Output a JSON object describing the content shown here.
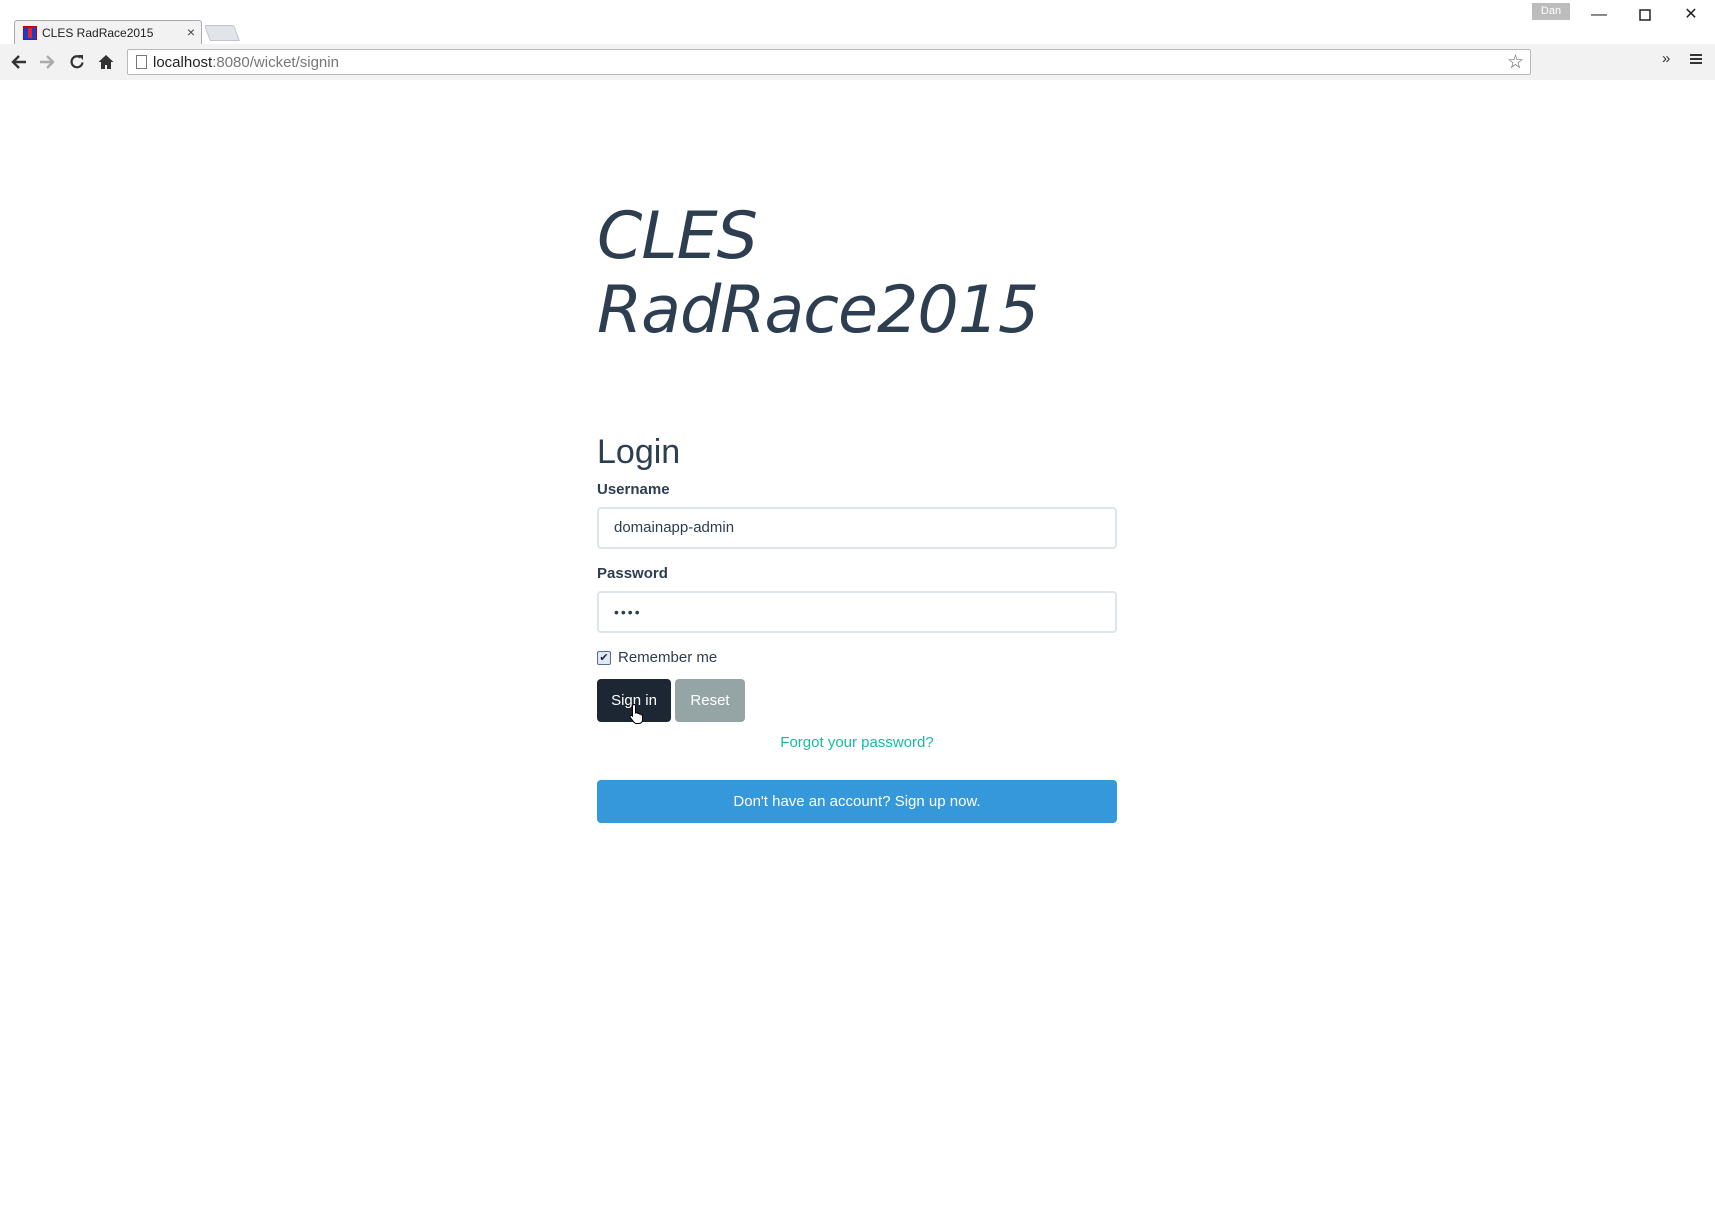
{
  "browser": {
    "tab_title": "CLES RadRace2015",
    "tab_close": "×",
    "profile_name": "Dan",
    "url_host": "localhost",
    "url_rest": ":8080/wicket/signin",
    "icons": [
      "back-arrow-icon",
      "forward-arrow-icon",
      "reload-icon",
      "home-icon",
      "page-icon",
      "star-icon",
      "chevron-right-icon",
      "menu-icon"
    ]
  },
  "page": {
    "app_title_line1": "CLES",
    "app_title_line2": "RadRace2015",
    "login_heading": "Login",
    "username_label": "Username",
    "username_value": "domainapp-admin",
    "password_label": "Password",
    "password_value": "••••",
    "remember_label": "Remember me",
    "remember_checked": true,
    "signin_label": "Sign in",
    "reset_label": "Reset",
    "forgot_label": "Forgot your password?",
    "signup_label": "Don't have an account? Sign up now."
  },
  "colors": {
    "text": "#2c3e50",
    "signin_bg": "#1c2733",
    "reset_bg": "#95a5a6",
    "link": "#18bc9c",
    "signup_bg": "#3498db"
  }
}
